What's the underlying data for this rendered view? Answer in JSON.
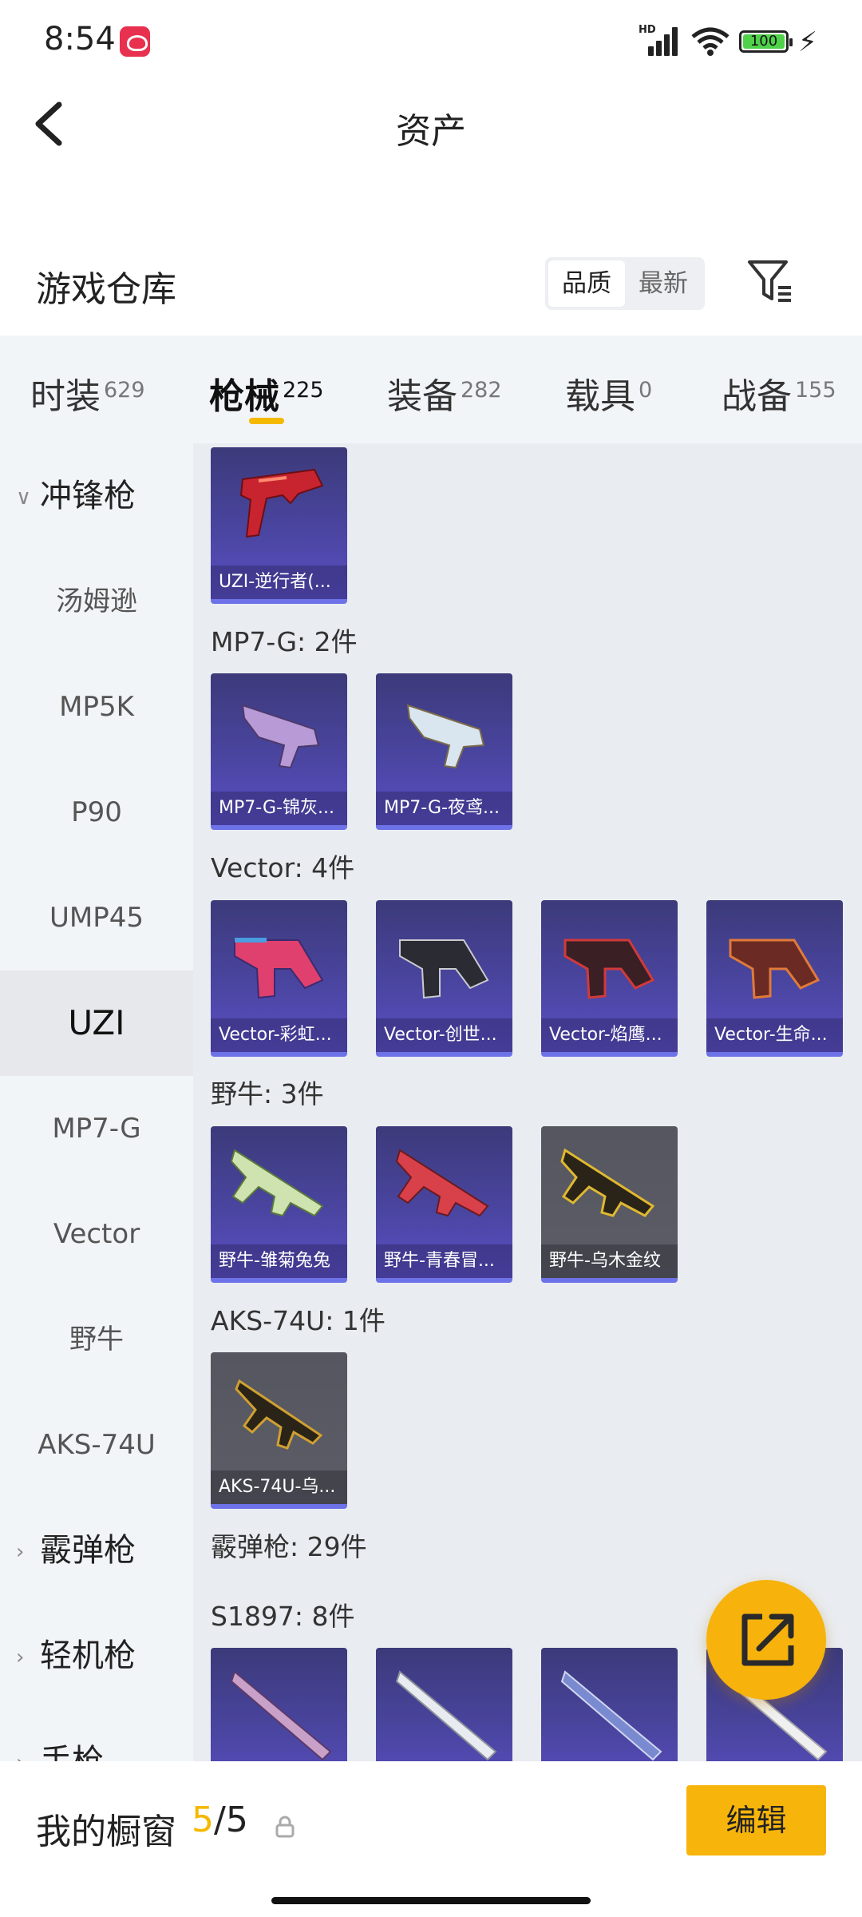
{
  "status": {
    "time": "8:54",
    "network": "HD",
    "battery": "100"
  },
  "header": {
    "title": "资产"
  },
  "section": {
    "title": "游戏仓库",
    "sort_options": [
      "品质",
      "最新"
    ]
  },
  "tabs": [
    {
      "name": "时装",
      "count": "629"
    },
    {
      "name": "枪械",
      "count": "225"
    },
    {
      "name": "装备",
      "count": "282"
    },
    {
      "name": "载具",
      "count": "0"
    },
    {
      "name": "战备",
      "count": "155"
    }
  ],
  "sidebar": {
    "group_open": "冲锋枪",
    "items": [
      "汤姆逊",
      "MP5K",
      "P90",
      "UMP45",
      "UZI",
      "MP7-G",
      "Vector",
      "野牛",
      "AKS-74U"
    ],
    "selected": "UZI",
    "groups_collapsed": [
      "霰弹枪",
      "轻机枪",
      "手枪"
    ]
  },
  "content": {
    "uzi_items": [
      "UZI-逆行者(..."
    ],
    "groups": [
      {
        "title": "MP7-G: 2件",
        "items": [
          "MP7-G-锦灰...",
          "MP7-G-夜鸢..."
        ]
      },
      {
        "title": "Vector: 4件",
        "items": [
          "Vector-彩虹...",
          "Vector-创世...",
          "Vector-焰鹰...",
          "Vector-生命..."
        ]
      },
      {
        "title": "野牛: 3件",
        "items": [
          "野牛-雏菊兔兔",
          "野牛-青春冒...",
          "野牛-乌木金纹"
        ]
      },
      {
        "title": "AKS-74U: 1件",
        "items": [
          "AKS-74U-乌..."
        ]
      },
      {
        "title": "霰弹枪: 29件"
      },
      {
        "title": "S1897: 8件"
      }
    ]
  },
  "bottom": {
    "label": "我的橱窗",
    "current": "5",
    "total": "/5",
    "edit": "编辑"
  },
  "colors": {
    "accent": "#f5b800",
    "card_purple": "#4a45a0",
    "card_gray": "#5c5d66"
  }
}
